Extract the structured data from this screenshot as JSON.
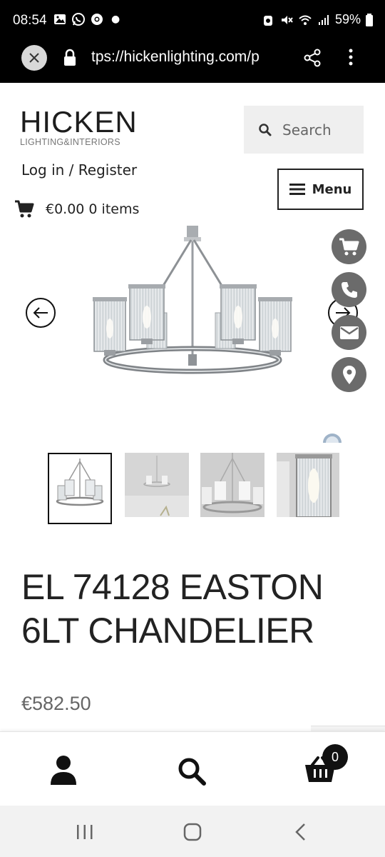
{
  "status_bar": {
    "time": "08:54",
    "battery": "59%"
  },
  "browser": {
    "url": "tps://hickenlighting.com/p"
  },
  "header": {
    "logo_main": "HICKEN",
    "logo_sub": "LIGHTING&INTERIORS",
    "search_placeholder": "Search",
    "login_label": "Log in / Register",
    "menu_label": "Menu",
    "cart_summary": "€0.00 0 items"
  },
  "product": {
    "title_line1": "EL 74128 EASTON",
    "title_line2": "6LT CHANDELIER",
    "price": "€582.50",
    "thumbnails": [
      "thumbnail-1",
      "thumbnail-2",
      "thumbnail-3",
      "thumbnail-4"
    ]
  },
  "bottom_nav": {
    "basket_count": "0"
  },
  "colors": {
    "float_button": "#6b6b6b",
    "chrome": "#000000",
    "text": "#222222"
  }
}
